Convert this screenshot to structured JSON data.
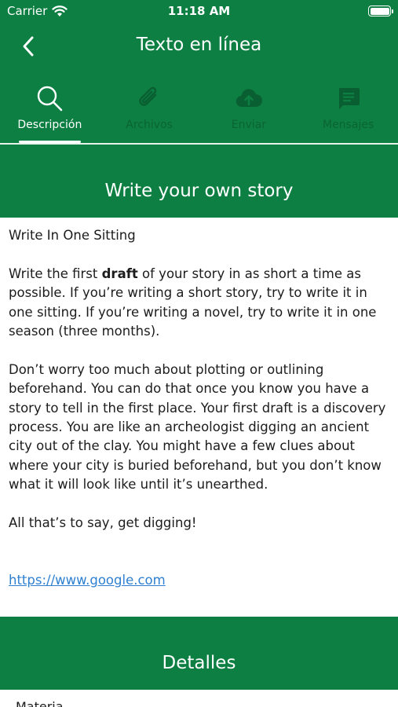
{
  "status_bar": {
    "carrier": "Carrier",
    "time": "11:18 AM"
  },
  "nav": {
    "title": "Texto en línea"
  },
  "tabs": [
    {
      "label": "Descripción",
      "icon": "search-icon",
      "active": true
    },
    {
      "label": "Archivos",
      "icon": "paperclip-icon",
      "active": false
    },
    {
      "label": "Enviar",
      "icon": "cloud-upload-icon",
      "active": false
    },
    {
      "label": "Mensajes",
      "icon": "message-icon",
      "active": false
    }
  ],
  "assignment": {
    "heading": "Write your own story",
    "subtitle": "Write In One Sitting",
    "p1_before": "Write the first ",
    "p1_bold": "draft",
    "p1_after": " of your story in as short a time as possible. If you’re writing a short story, try to write it in one sitting. If you’re writing a novel, try to write it in one season (three months).",
    "p2": "Don’t worry too much about plotting or outlining beforehand. You can do that once you know you have a story to tell in the first place. Your first draft is a discovery process. You are like an archeologist digging an ancient city out of the clay. You might have a few clues about where your city is buried beforehand, but you don’t know what it will look like until it’s unearthed.",
    "p3": "All that’s to say, get digging!",
    "link": "https://www.google.com"
  },
  "details": {
    "heading": "Detalles",
    "materia_label": "Materia"
  },
  "colors": {
    "primary": "#0d7f42",
    "link": "#2f80d1"
  }
}
